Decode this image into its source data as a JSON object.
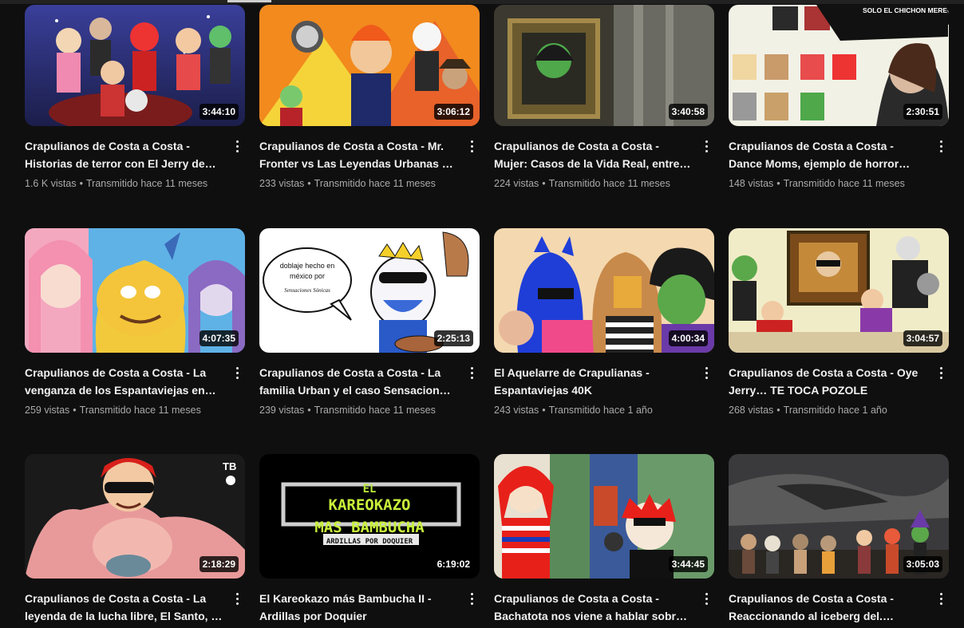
{
  "videos": [
    {
      "title": "Crapulianos de Costa a Costa - Historias de terror con El Jerry de…",
      "duration": "3:44:10",
      "views": "1.6 K vistas",
      "age": "Transmitido hace 11 meses"
    },
    {
      "title": "Crapulianos de Costa a Costa - Mr. Fronter vs Las Leyendas Urbanas …",
      "duration": "3:06:12",
      "views": "233 vistas",
      "age": "Transmitido hace 11 meses"
    },
    {
      "title": "Crapulianos de Costa a Costa - Mujer: Casos de la Vida Real, entre…",
      "duration": "3:40:58",
      "views": "224 vistas",
      "age": "Transmitido hace 11 meses"
    },
    {
      "title": "Crapulianos de Costa a Costa - Dance Moms, ejemplo de horror…",
      "duration": "2:30:51",
      "views": "148 vistas",
      "age": "Transmitido hace 11 meses"
    },
    {
      "title": "Crapulianos de Costa a Costa - La venganza de los Espantaviejas en…",
      "duration": "4:07:35",
      "views": "259 vistas",
      "age": "Transmitido hace 11 meses"
    },
    {
      "title": "Crapulianos de Costa a Costa - La familia Urban y el caso Sensacion…",
      "duration": "2:25:13",
      "views": "239 vistas",
      "age": "Transmitido hace 11 meses"
    },
    {
      "title": "El Aquelarre de Crapulianas - Espantaviejas 40K",
      "duration": "4:00:34",
      "views": "243 vistas",
      "age": "Transmitido hace 1 año"
    },
    {
      "title": "Crapulianos de Costa a Costa - Oye Jerry… TE TOCA POZOLE",
      "duration": "3:04:57",
      "views": "268 vistas",
      "age": "Transmitido hace 1 año"
    },
    {
      "title": "Crapulianos de Costa a Costa - La leyenda de la lucha libre, El Santo, …",
      "duration": "2:18:29",
      "views": "",
      "age": ""
    },
    {
      "title": "El Kareokazo más Bambucha II - Ardillas por Doquier",
      "duration": "6:19:02",
      "views": "",
      "age": ""
    },
    {
      "title": "Crapulianos de Costa a Costa - Bachatota nos viene a hablar sobr…",
      "duration": "3:44:45",
      "views": "",
      "age": ""
    },
    {
      "title": "Crapulianos de Costa a Costa - Reaccionando al iceberg del.…",
      "duration": "3:05:03",
      "views": "",
      "age": ""
    }
  ],
  "thumb_text": {
    "t4_bubble": "SOLO EL CHICHON MERECE ESTAR EN LA PUNTA DE LA PIRÁMIDE!",
    "t6_bubble_1": "doblaje hecho en",
    "t6_bubble_2": "méxico por",
    "t6_bubble_3": "Sensaciones Sónicas",
    "t9_mark": "TB",
    "t10_line1": "EL",
    "t10_line2": "KAREOKAZO",
    "t10_line3": "MAS BAMBUCHA",
    "t10_line4": "ARDILLAS POR DOQUIER"
  },
  "separator": "•",
  "colors": {
    "bg": "#0f0f0f",
    "text": "#f1f1f1",
    "muted": "#aaaaaa"
  }
}
